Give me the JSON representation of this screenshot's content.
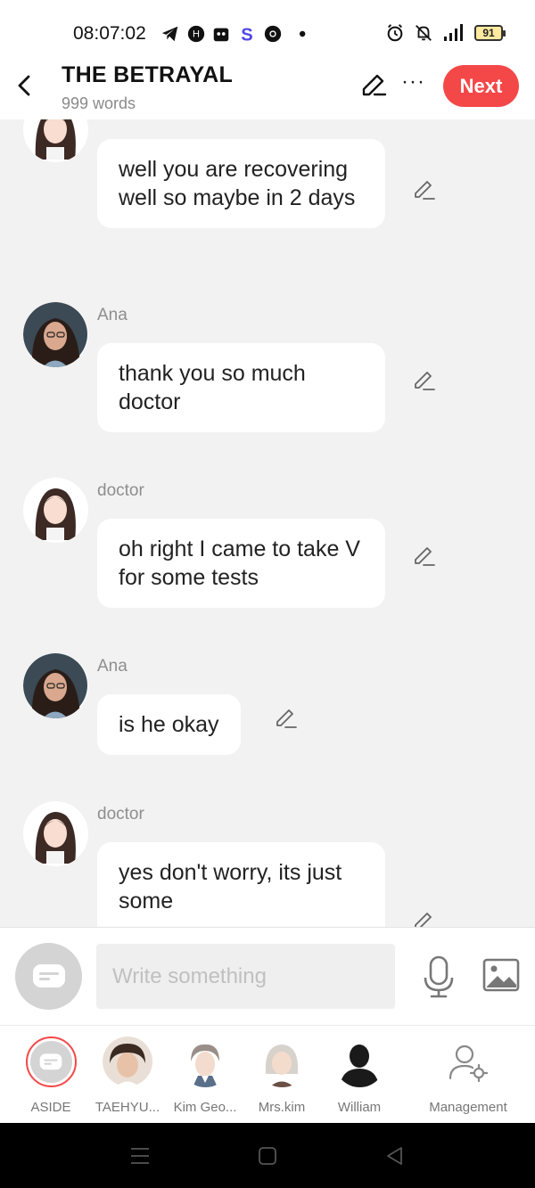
{
  "status_bar": {
    "time": "08:07:02",
    "battery": "91"
  },
  "header": {
    "title": "THE BETRAYAL",
    "word_count": "999 words",
    "next_label": "Next",
    "more_label": "···"
  },
  "messages": [
    {
      "speaker": "",
      "text": "well you are recovering well so maybe in 2 days"
    },
    {
      "speaker": "Ana",
      "text": "thank you so much doctor"
    },
    {
      "speaker": "doctor",
      "text": "oh right I came to take V for some tests"
    },
    {
      "speaker": "Ana",
      "text": "is he okay"
    },
    {
      "speaker": "doctor",
      "text": "yes don't worry, its just some"
    }
  ],
  "input": {
    "placeholder": "Write something"
  },
  "characters": [
    {
      "label": "ASIDE"
    },
    {
      "label": "TAEHYU..."
    },
    {
      "label": "Kim Geo..."
    },
    {
      "label": "Mrs.kim"
    },
    {
      "label": "William"
    },
    {
      "label": "Management"
    }
  ],
  "colors": {
    "accent": "#f44848",
    "background": "#f2f2f2",
    "bubble": "#ffffff"
  }
}
